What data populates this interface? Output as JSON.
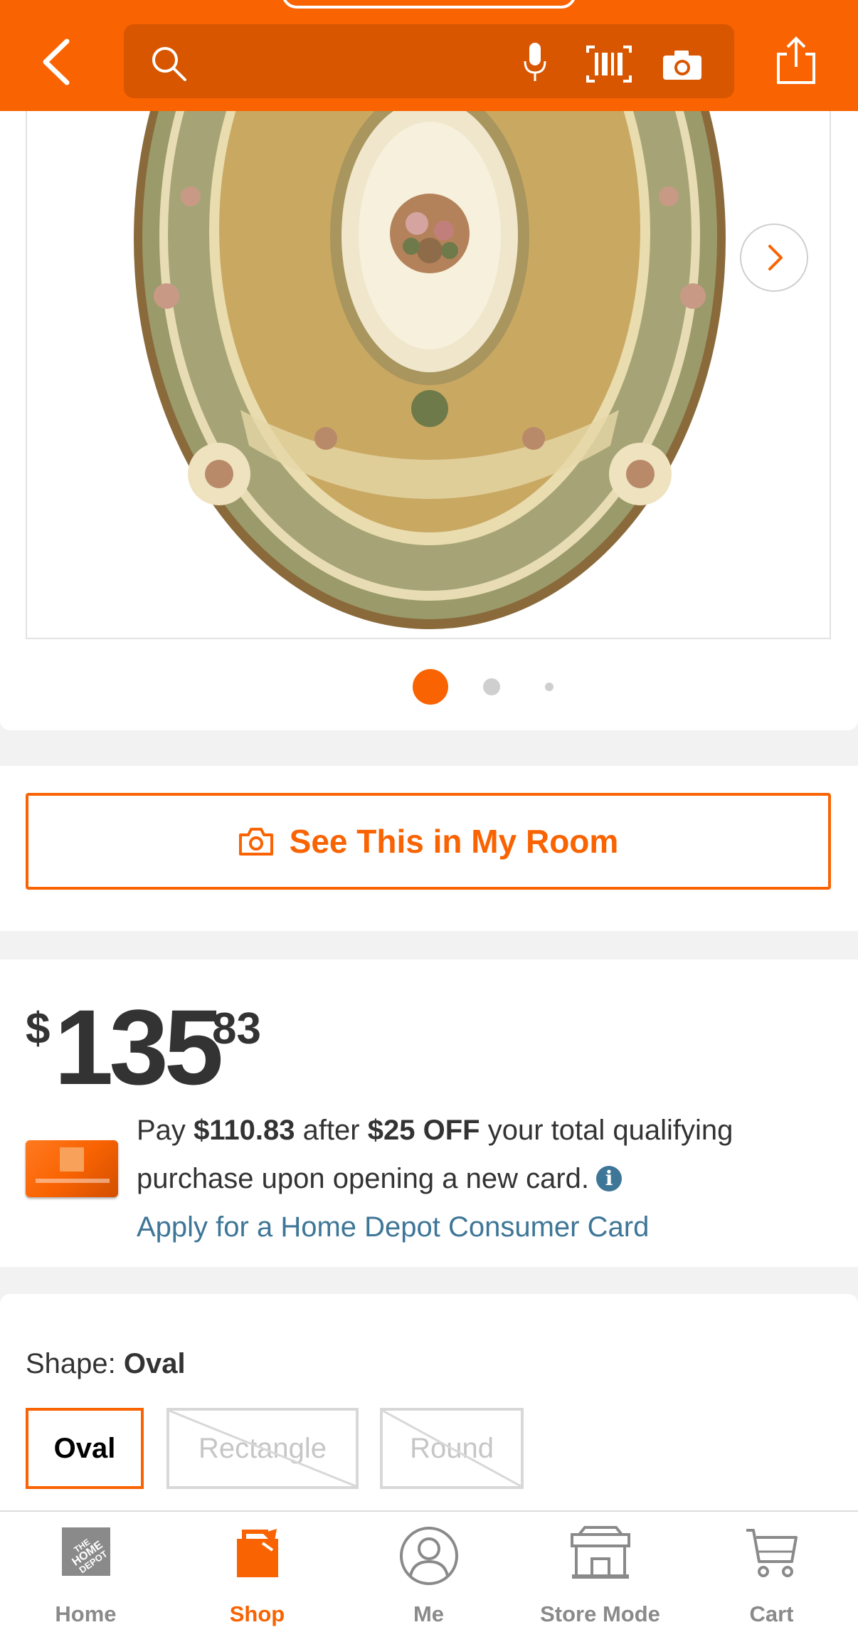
{
  "header": {
    "search_placeholder": "",
    "icons": [
      "back-icon",
      "search-icon",
      "microphone-icon",
      "barcode-icon",
      "camera-icon",
      "share-icon"
    ]
  },
  "gallery": {
    "image_description": "oval rug",
    "active_dot": 1,
    "dot_count": 3
  },
  "room_button": {
    "label": "See This in My Room"
  },
  "price": {
    "currency": "$",
    "whole": "135",
    "cents": "83"
  },
  "offer": {
    "pay_prefix": "Pay",
    "pay_amount": "$110.83",
    "after": "after",
    "discount": "$25 OFF",
    "rest": "your total qualifying purchase upon opening a new card.",
    "info_glyph": "i",
    "apply_link": "Apply for a Home Depot Consumer Card"
  },
  "shape": {
    "label": "Shape:",
    "selected": "Oval",
    "options": [
      {
        "label": "Oval",
        "state": "selected"
      },
      {
        "label": "Rectangle",
        "state": "unavailable"
      },
      {
        "label": "Round",
        "state": "unavailable"
      }
    ]
  },
  "nav": {
    "items": [
      {
        "label": "Home",
        "icon": "home-depot-logo-icon"
      },
      {
        "label": "Shop",
        "icon": "shop-bag-icon",
        "active": true
      },
      {
        "label": "Me",
        "icon": "person-icon"
      },
      {
        "label": "Store Mode",
        "icon": "store-icon"
      },
      {
        "label": "Cart",
        "icon": "cart-icon"
      }
    ]
  },
  "colors": {
    "brand_orange": "#f96302",
    "search_bg": "#d85600",
    "link_blue": "#3e7697",
    "text_dark": "#333333",
    "nav_gray": "#8a8a8a"
  }
}
